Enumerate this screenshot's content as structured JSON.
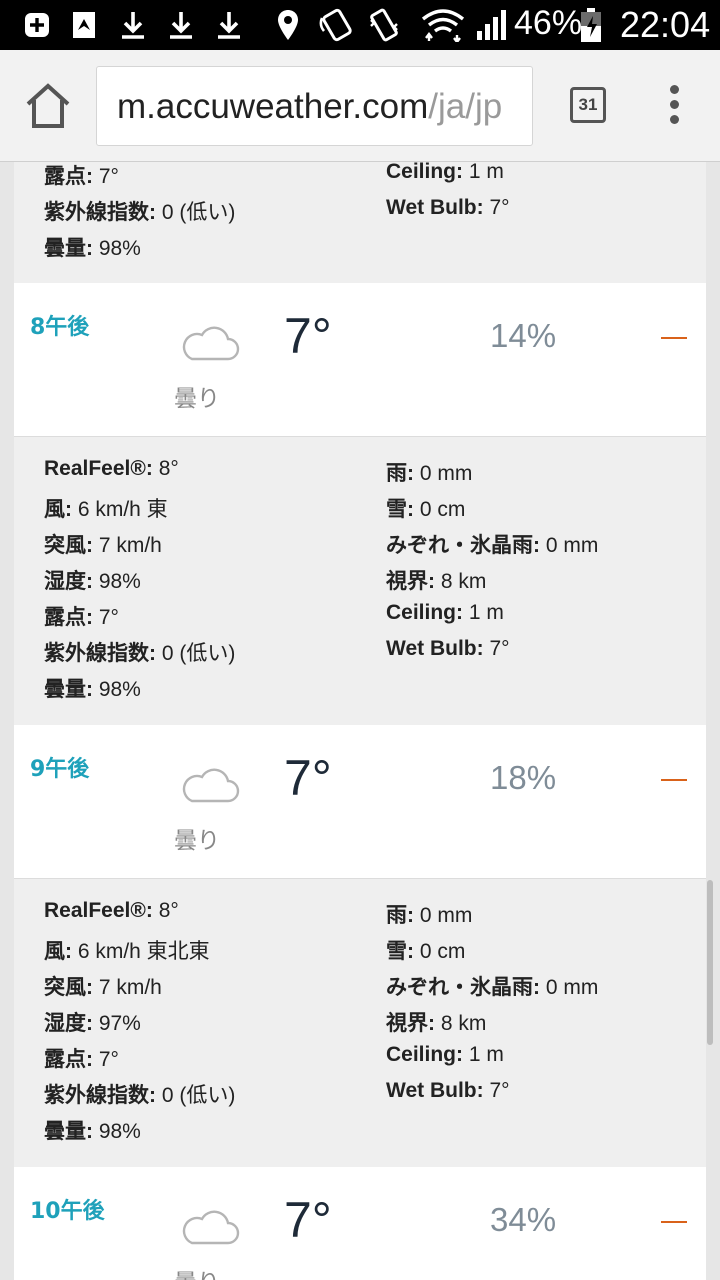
{
  "status_bar": {
    "battery_percent": "46%",
    "time": "22:04",
    "icons": [
      "plus-square-icon",
      "navigation-app-icon",
      "download-icon",
      "download-icon",
      "download-icon",
      "location-pin-icon",
      "nfc-icon",
      "vibrate-icon",
      "wifi-icon",
      "signal-icon",
      "battery-icon"
    ]
  },
  "browser": {
    "url_host": "m.accuweather.com",
    "url_path": "/ja/jp",
    "tab_count": "31"
  },
  "partial_top": {
    "left": [
      {
        "label": "露点",
        "value": "7°"
      },
      {
        "label": "紫外線指数",
        "value": "0 (低い)"
      },
      {
        "label": "曇量",
        "value": "98%"
      }
    ],
    "right": [
      {
        "label": "Ceiling",
        "value": "1 m"
      },
      {
        "label": "Wet Bulb",
        "value": "7°"
      }
    ]
  },
  "hours": [
    {
      "time": "8午後",
      "condition": "曇り",
      "temp": "7°",
      "precip": "14%",
      "left": [
        {
          "label": "RealFeel®",
          "value": "8°"
        },
        {
          "label": "風",
          "value": "6 km/h 東"
        },
        {
          "label": "突風",
          "value": "7 km/h"
        },
        {
          "label": "湿度",
          "value": "98%"
        },
        {
          "label": "露点",
          "value": "7°"
        },
        {
          "label": "紫外線指数",
          "value": "0 (低い)"
        },
        {
          "label": "曇量",
          "value": "98%"
        }
      ],
      "right": [
        {
          "label": "雨",
          "value": "0 mm"
        },
        {
          "label": "雪",
          "value": "0 cm"
        },
        {
          "label": "みぞれ・氷晶雨",
          "value": "0 mm"
        },
        {
          "label": "視界",
          "value": "8 km"
        },
        {
          "label": "Ceiling",
          "value": "1 m"
        },
        {
          "label": "Wet Bulb",
          "value": "7°"
        }
      ]
    },
    {
      "time": "9午後",
      "condition": "曇り",
      "temp": "7°",
      "precip": "18%",
      "left": [
        {
          "label": "RealFeel®",
          "value": "8°"
        },
        {
          "label": "風",
          "value": "6 km/h 東北東"
        },
        {
          "label": "突風",
          "value": "7 km/h"
        },
        {
          "label": "湿度",
          "value": "97%"
        },
        {
          "label": "露点",
          "value": "7°"
        },
        {
          "label": "紫外線指数",
          "value": "0 (低い)"
        },
        {
          "label": "曇量",
          "value": "98%"
        }
      ],
      "right": [
        {
          "label": "雨",
          "value": "0 mm"
        },
        {
          "label": "雪",
          "value": "0 cm"
        },
        {
          "label": "みぞれ・氷晶雨",
          "value": "0 mm"
        },
        {
          "label": "視界",
          "value": "8 km"
        },
        {
          "label": "Ceiling",
          "value": "1 m"
        },
        {
          "label": "Wet Bulb",
          "value": "7°"
        }
      ]
    },
    {
      "time": "10午後",
      "condition": "曇り",
      "temp": "7°",
      "precip": "34%"
    }
  ],
  "colors": {
    "hour_label": "#1ea1ba",
    "temperature": "#1e2a38",
    "precip": "#7f8c97",
    "dash": "#d9621a",
    "detail_bg": "#efefef"
  }
}
